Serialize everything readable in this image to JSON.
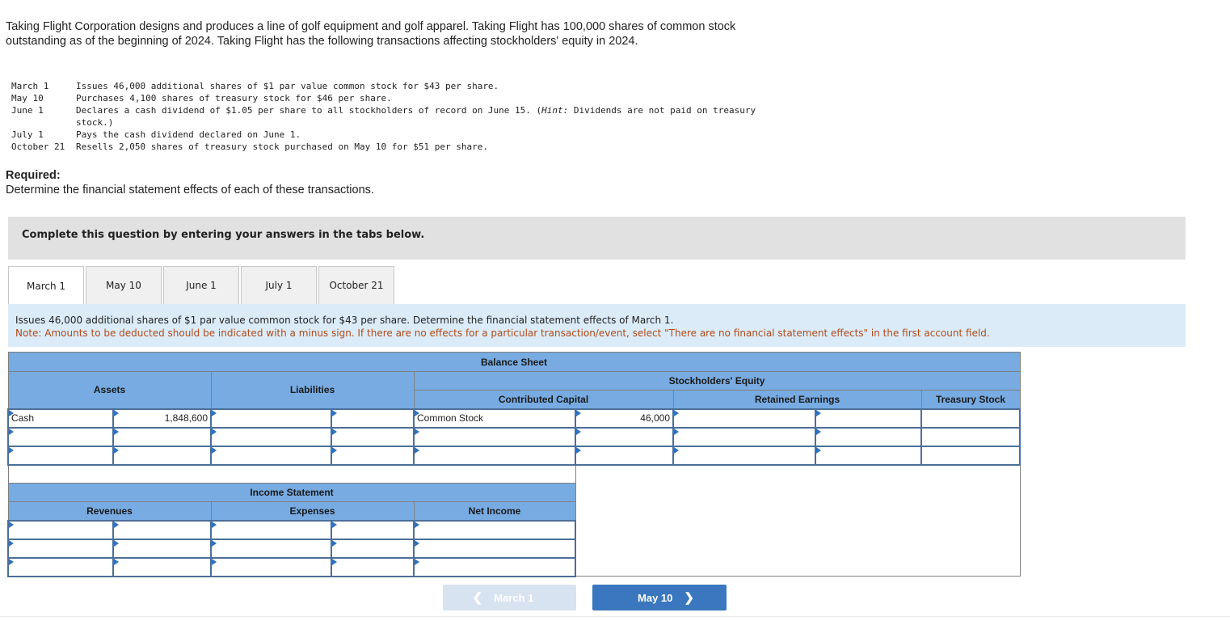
{
  "intro": "Taking Flight Corporation designs and produces a line of golf equipment and golf apparel. Taking Flight has 100,000 shares of common stock outstanding as of the beginning of 2024. Taking Flight has the following transactions affecting stockholders' equity in 2024.",
  "transactions": [
    {
      "date": "March 1",
      "desc": "Issues 46,000 additional shares of $1 par value common stock for $43 per share."
    },
    {
      "date": "May 10",
      "desc": "Purchases 4,100 shares of treasury stock for $46 per share."
    },
    {
      "date": "June 1",
      "desc": "Declares a cash dividend of $1.05 per share to all stockholders of record on June 15. (Hint: Dividends are not paid on treasury stock.)"
    },
    {
      "date": "July 1",
      "desc": "Pays the cash dividend declared on June 1."
    },
    {
      "date": "October 21",
      "desc": "Resells 2,050 shares of treasury stock purchased on May 10 for $51 per share."
    }
  ],
  "required": {
    "label": "Required:",
    "text": "Determine the financial statement effects of each of these transactions."
  },
  "banner": "Complete this question by entering your answers in the tabs below.",
  "tabs": [
    {
      "label": "March 1",
      "active": true
    },
    {
      "label": "May 10",
      "active": false
    },
    {
      "label": "June 1",
      "active": false
    },
    {
      "label": "July 1",
      "active": false
    },
    {
      "label": "October 21",
      "active": false
    }
  ],
  "instructions": {
    "question": "Issues 46,000 additional shares of $1 par value common stock for $43 per share. Determine the financial statement effects of March 1.",
    "note": "Note: Amounts to be deducted should be indicated with a minus sign. If there are no effects for a particular transaction/event, select \"There are no financial statement effects\" in the first account field."
  },
  "balance_sheet": {
    "title": "Balance Sheet",
    "assets": "Assets",
    "liabilities": "Liabilities",
    "stockholders_equity": "Stockholders' Equity",
    "contributed_capital": "Contributed Capital",
    "retained_earnings": "Retained Earnings",
    "treasury_stock": "Treasury Stock",
    "rows": [
      [
        "Cash",
        "1,848,600",
        "",
        "",
        "Common Stock",
        "46,000",
        "",
        "",
        ""
      ],
      [
        "",
        "",
        "",
        "",
        "",
        "",
        "",
        "",
        ""
      ],
      [
        "",
        "",
        "",
        "",
        "",
        "",
        "",
        "",
        ""
      ]
    ]
  },
  "income_statement": {
    "title": "Income Statement",
    "revenues": "Revenues",
    "expenses": "Expenses",
    "net_income": "Net Income",
    "rows": [
      [
        "",
        "",
        "",
        "",
        ""
      ],
      [
        "",
        "",
        "",
        "",
        ""
      ],
      [
        "",
        "",
        "",
        "",
        ""
      ]
    ]
  },
  "nav": {
    "prev": "March 1",
    "next": "May 10"
  }
}
